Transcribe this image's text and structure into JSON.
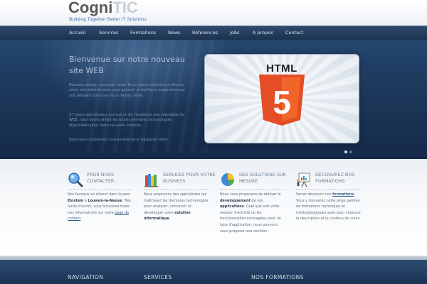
{
  "logo": {
    "word_main": "Cogni",
    "word_accent": "TIC",
    "tagline": "Building Together Better IT Solutions"
  },
  "nav": {
    "items": [
      "Accueil",
      "Services",
      "Formations",
      "News",
      "Références",
      "Jobs",
      "A propos",
      "Contact"
    ]
  },
  "hero": {
    "title": "Bienvenue sur notre nouveau site WEB",
    "paragraphs": [
      "Nouveau design, nouveau code! Nous avons totalement refondu notre site internet pour vous garantir la meilleure expérience qui soit pendant que vous nous rendez visite.",
      "A l'heure des réseaux sociaux et de l'évolution des standards du WEB, nous avons utilisé les toutes dernières technologies disponibles pour notre nouvelle création.",
      "Nous vous souhaitons une excellente et agréable visite."
    ],
    "slide_label": "HTML",
    "slide_badge": "5",
    "slider": {
      "count": 2,
      "active_index": 0
    }
  },
  "features": [
    {
      "title": "Pour nous contacter...",
      "icon": "magnifier-icon",
      "text": [
        {
          "t": "Nos bureaux se situent dans le parc "
        },
        {
          "t": "Einstein",
          "b": true
        },
        {
          "t": " à "
        },
        {
          "t": "Louvain-la-Neuve",
          "b": true
        },
        {
          "t": ". Très facile d'accès, vous trouverez toute nos informations sur notre "
        },
        {
          "t": "page de contact",
          "a": true
        },
        {
          "t": "."
        }
      ]
    },
    {
      "title": "Services pour votre business",
      "icon": "books-icon",
      "text": [
        {
          "t": "Nous proposons des spécialistes qui maîtrisent les dernières technologies pour analyser, concevoir et développer votre "
        },
        {
          "t": "solution informatique",
          "b": true
        },
        {
          "t": "."
        }
      ]
    },
    {
      "title": "Des solutions sur mesure",
      "icon": "pie-chart-icon",
      "text": [
        {
          "t": "Nous vous proposons de réaliser le "
        },
        {
          "t": "développement",
          "b": true
        },
        {
          "t": " de vos "
        },
        {
          "t": "applications",
          "b": true
        },
        {
          "t": ". Quel que soit votre secteur d'activité ou les fonctionnalités envisagées pour un type d'application, nous pouvons vous proposer une solution."
        }
      ]
    },
    {
      "title": "Découvrez nos formations",
      "icon": "presentation-board-icon",
      "text": [
        {
          "t": "Venez découvrir nos "
        },
        {
          "t": "formations",
          "a": true,
          "b": true
        },
        {
          "t": ". Vous y trouverez notre large gamme de formations techniques et méthodologiques avec pour chacune la description et le contenu du cours."
        }
      ]
    }
  ],
  "footer": {
    "headings": [
      "NAVIGATION",
      "SERVICES",
      "NOS FORMATIONS"
    ]
  },
  "colors": {
    "brand_blue": "#3d6fae",
    "nav_dark": "#1c3350",
    "html5_orange": "#e44d26",
    "html5_orange_light": "#f16529"
  }
}
